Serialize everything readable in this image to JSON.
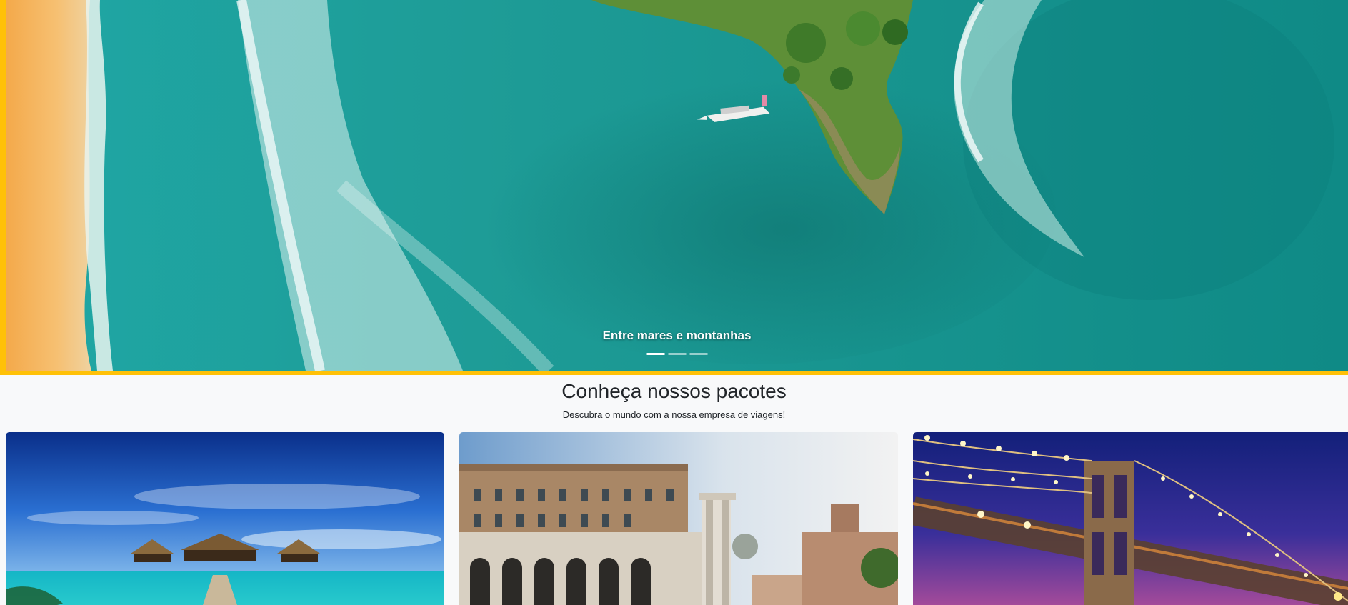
{
  "hero": {
    "caption": "Entre mares e montanhas",
    "indicators": [
      {
        "active": true
      },
      {
        "active": false
      },
      {
        "active": false
      }
    ],
    "accent_color": "#ffc107"
  },
  "packages": {
    "title": "Conheça nossos pacotes",
    "subtitle": "Descubra o mundo com a nossa empresa de viagens!"
  }
}
